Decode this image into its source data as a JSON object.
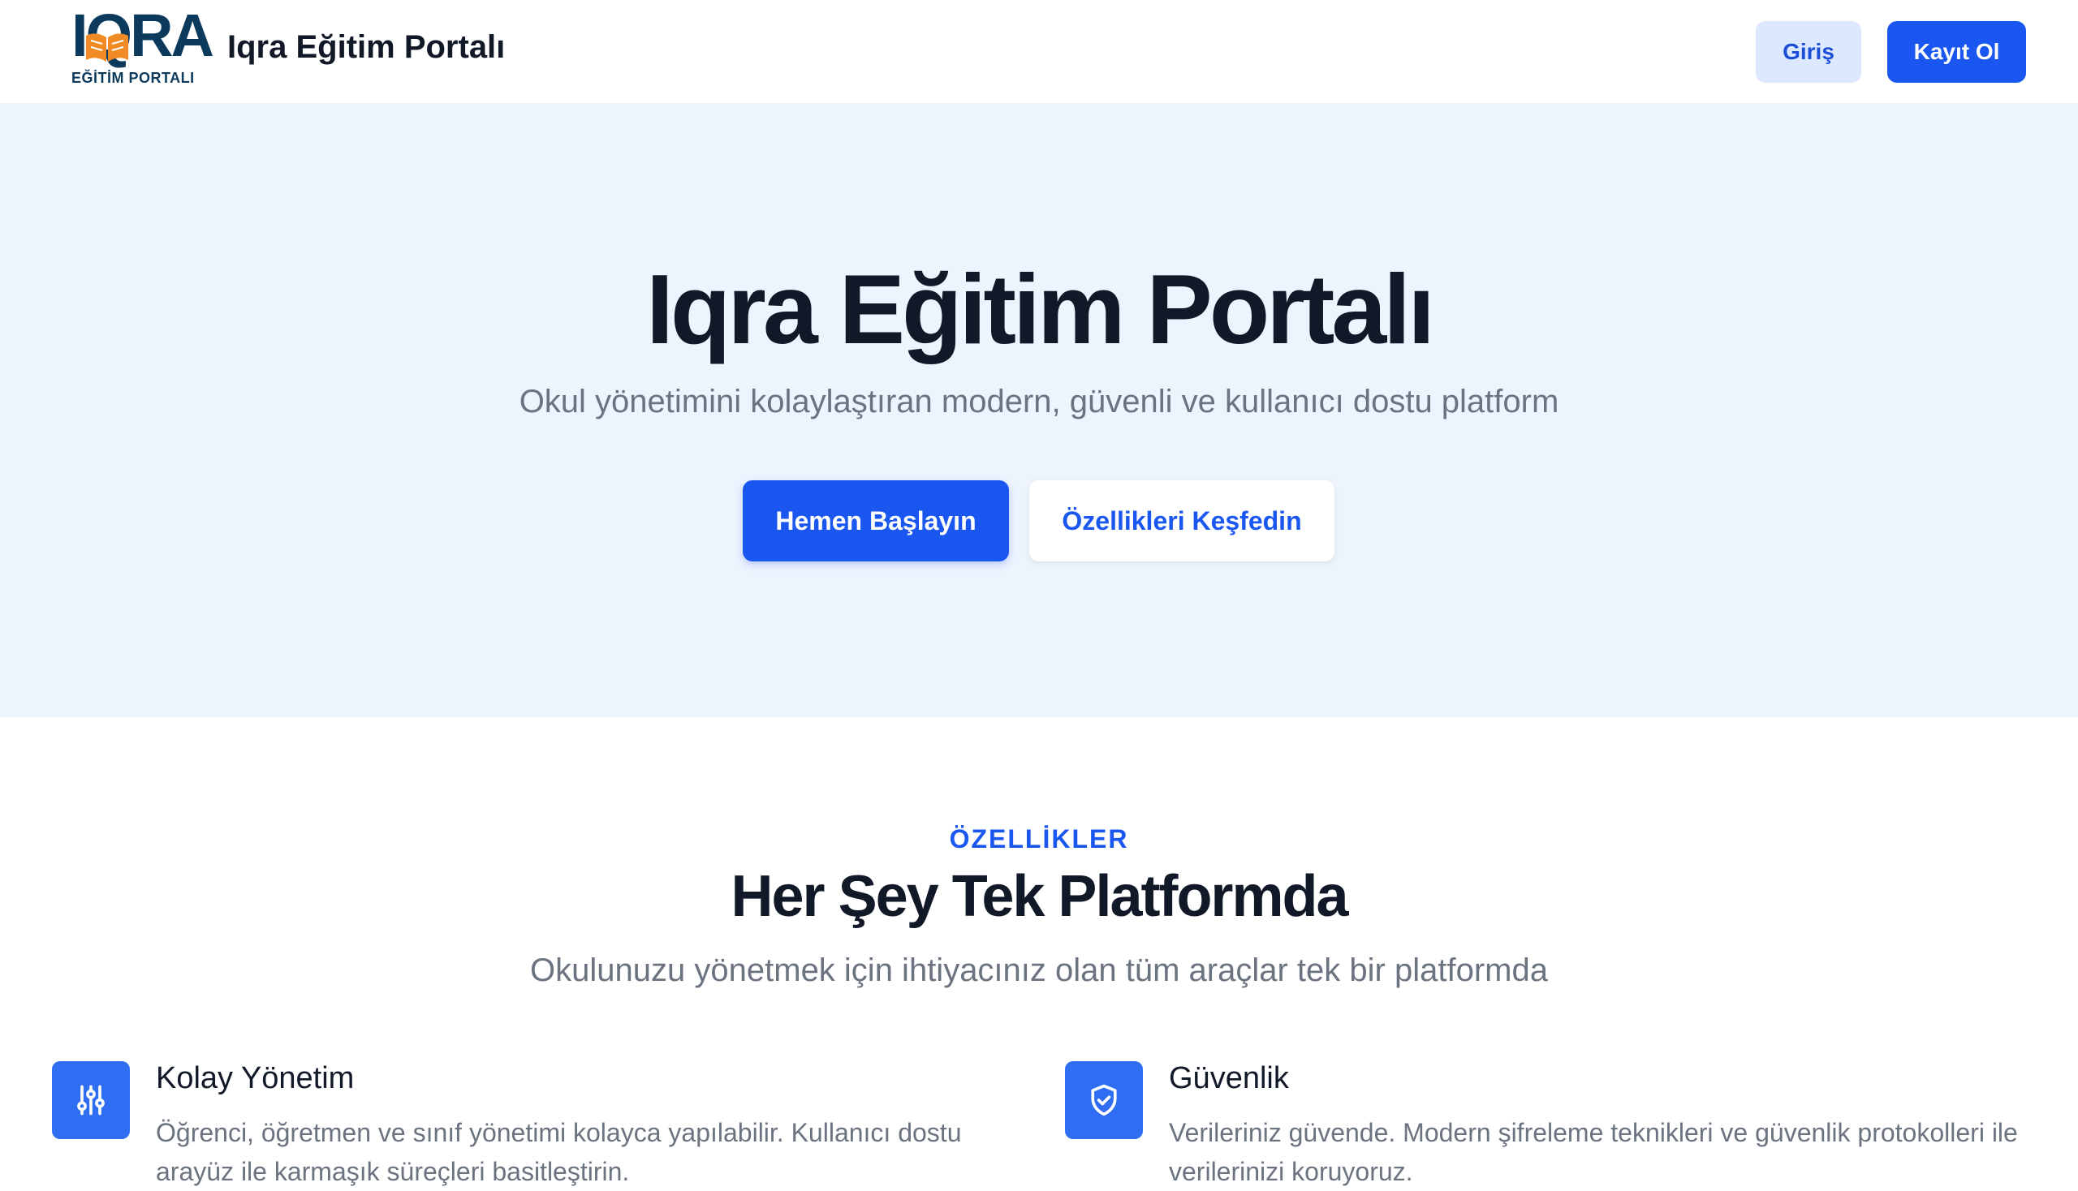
{
  "header": {
    "logo_text": "IQRA",
    "logo_subtext": "EĞİTİM PORTALI",
    "brand_title": "Iqra Eğitim Portalı",
    "login_label": "Giriş",
    "register_label": "Kayıt Ol"
  },
  "hero": {
    "title": "Iqra Eğitim Portalı",
    "subtitle": "Okul yönetimini kolaylaştıran modern, güvenli ve kullanıcı dostu platform",
    "primary_cta": "Hemen Başlayın",
    "secondary_cta": "Özellikleri Keşfedin"
  },
  "features": {
    "eyebrow": "ÖZELLİKLER",
    "title": "Her Şey Tek Platformda",
    "subtitle": "Okulunuzu yönetmek için ihtiyacınız olan tüm araçlar tek bir platformda",
    "items": [
      {
        "icon": "sliders-icon",
        "title": "Kolay Yönetim",
        "description": "Öğrenci, öğretmen ve sınıf yönetimi kolayca yapılabilir. Kullanıcı dostu arayüz ile karmaşık süreçleri basitleştirin."
      },
      {
        "icon": "shield-check-icon",
        "title": "Güvenlik",
        "description": "Verileriniz güvende. Modern şifreleme teknikleri ve güvenlik protokolleri ile verilerinizi koruyoruz."
      }
    ]
  },
  "colors": {
    "primary": "#1a56f0",
    "hero_bg": "#eef4fe",
    "text_dark": "#111827",
    "text_muted": "#6b7280",
    "logo_navy": "#0c3a5c",
    "logo_orange": "#f08a24"
  }
}
